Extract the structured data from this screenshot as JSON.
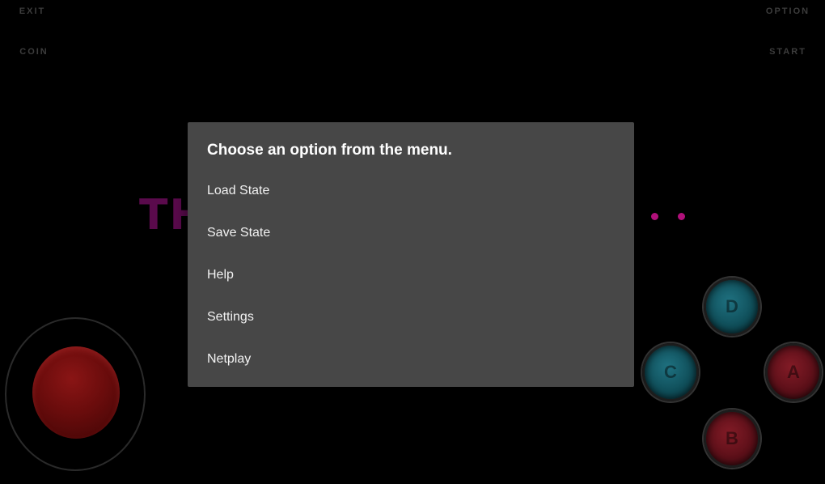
{
  "controls": {
    "exit": "EXIT",
    "coin": "COIN",
    "option": "OPTION",
    "start": "START"
  },
  "game_screen": {
    "title_fragment": "TH"
  },
  "dialog": {
    "title": "Choose an option from the menu.",
    "items": [
      {
        "label": "Load State"
      },
      {
        "label": "Save State"
      },
      {
        "label": "Help"
      },
      {
        "label": "Settings"
      },
      {
        "label": "Netplay"
      }
    ]
  },
  "face_buttons": {
    "d": "D",
    "c": "C",
    "a": "A",
    "b": "B"
  },
  "colors": {
    "dialog_bg": "#474747",
    "teal_button": "#1f7180",
    "red_button": "#821b26",
    "title_magenta": "#5a0a4c"
  }
}
